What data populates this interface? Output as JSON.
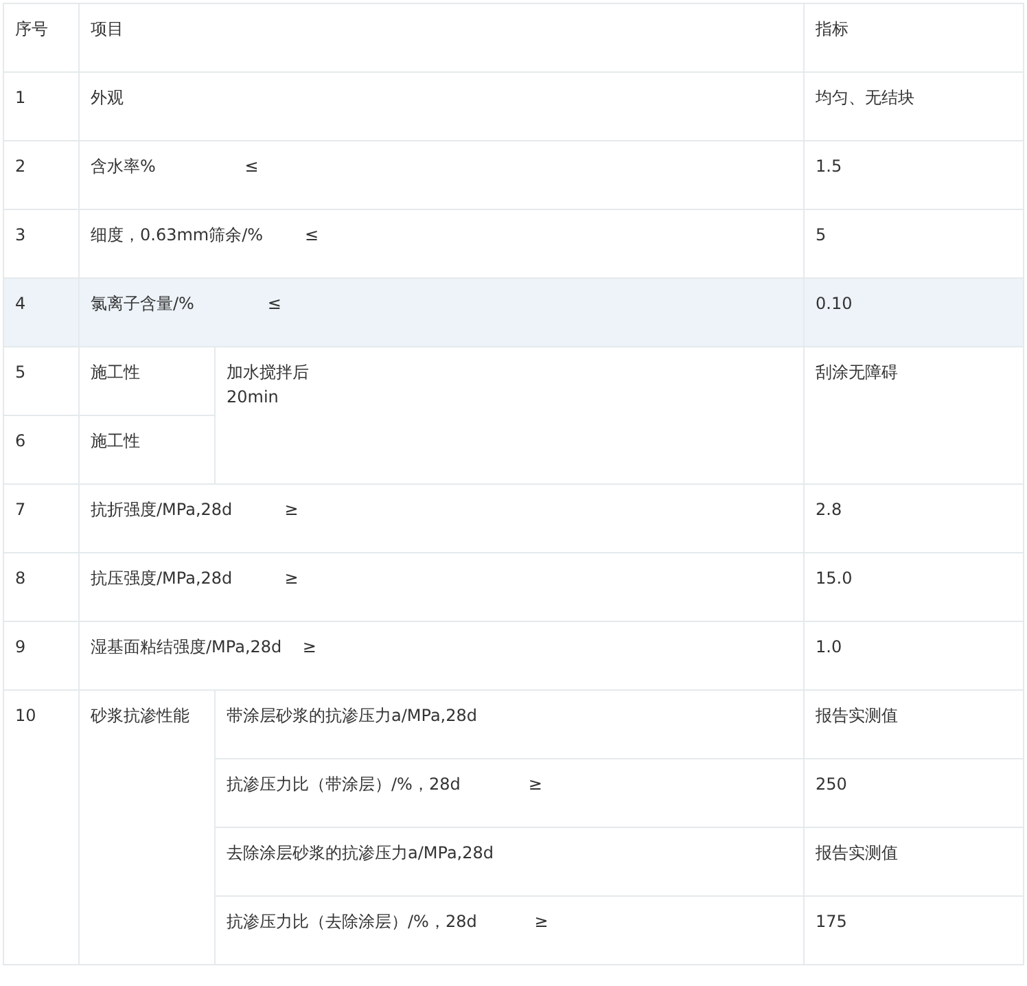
{
  "table": {
    "header": {
      "no": "序号",
      "item": "项目",
      "value": "指标"
    },
    "rows": [
      {
        "kind": "simple",
        "no": "1",
        "item": "外观",
        "value": "均匀、无结块",
        "highlighted": false
      },
      {
        "kind": "simple",
        "no": "2",
        "item": "含水率%                 ≤",
        "value": "1.5",
        "highlighted": false
      },
      {
        "kind": "simple",
        "no": "3",
        "item": "细度，0.63mm筛余/%        ≤",
        "value": "5",
        "highlighted": false
      },
      {
        "kind": "simple",
        "no": "4",
        "item": "氯离子含量/%              ≤",
        "value": "0.10",
        "highlighted": true
      },
      {
        "kind": "shared",
        "entries": [
          {
            "no": "5",
            "item": "施工性"
          },
          {
            "no": "6",
            "item": "施工性"
          }
        ],
        "condition": "加水搅拌后\n20min",
        "value": "刮涂无障碍",
        "highlighted": false
      },
      {
        "kind": "simple",
        "no": "7",
        "item": "抗折强度/MPa,28d          ≥",
        "value": "2.8",
        "highlighted": false
      },
      {
        "kind": "simple",
        "no": "8",
        "item": "抗压强度/MPa,28d          ≥",
        "value": "15.0",
        "highlighted": false
      },
      {
        "kind": "simple",
        "no": "9",
        "item": "湿基面粘结强度/MPa,28d    ≥",
        "value": "1.0",
        "highlighted": false
      },
      {
        "kind": "group",
        "no": "10",
        "item": "砂浆抗渗性能",
        "highlighted": false,
        "entries": [
          {
            "item": "带涂层砂浆的抗渗压力a/MPa,28d",
            "value": "报告实测值"
          },
          {
            "item": "抗渗压力比（带涂层）/%，28d             ≥",
            "value": "250"
          },
          {
            "item": "去除涂层砂浆的抗渗压力a/MPa,28d",
            "value": "报告实测值"
          },
          {
            "item": "抗渗压力比（去除涂层）/%，28d           ≥",
            "value": "175"
          }
        ]
      }
    ]
  }
}
